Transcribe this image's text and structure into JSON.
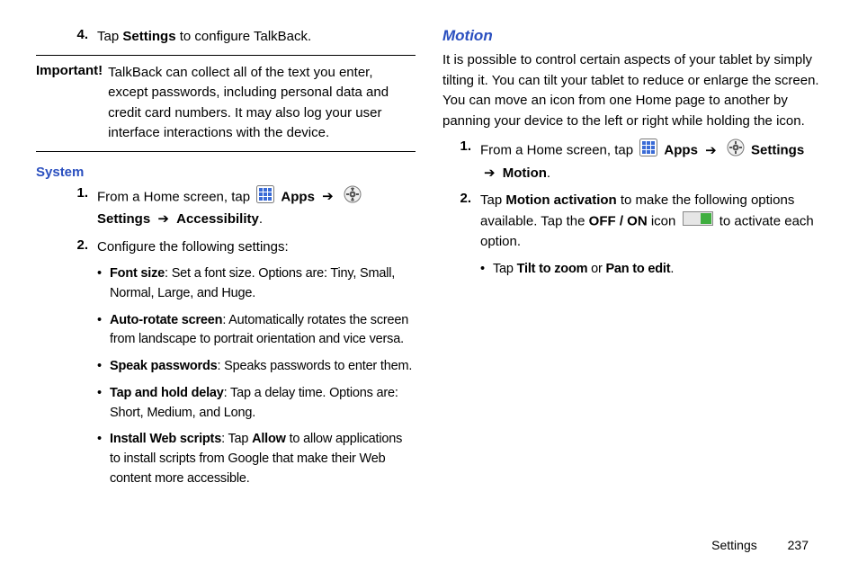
{
  "left": {
    "step4_num": "4.",
    "step4_pre": "Tap ",
    "step4_bold": "Settings",
    "step4_post": " to configure TalkBack.",
    "important_label": "Important!",
    "important_body": "TalkBack can collect all of the text you enter, except passwords, including personal data and credit card numbers. It may also log your user interface interactions with the device.",
    "system_head": "System",
    "sys1_num": "1.",
    "sys1_pre": "From a Home screen, tap ",
    "apps_label": "Apps",
    "settings_label": "Settings",
    "sys1_target": "Accessibility",
    "sys2_num": "2.",
    "sys2_body": "Configure the following settings:",
    "bullets": [
      {
        "b": "Font size",
        "t": ": Set a font size. Options are: Tiny, Small, Normal, Large, and Huge."
      },
      {
        "b": "Auto-rotate screen",
        "t": ": Automatically rotates the screen from landscape to portrait orientation and vice versa."
      },
      {
        "b": "Speak passwords",
        "t": ": Speaks passwords to enter them."
      },
      {
        "b": "Tap and hold delay",
        "t": ": Tap a delay time. Options are: Short, Medium, and Long."
      },
      {
        "b": "Install Web scripts",
        "t1": ": Tap ",
        "b2": "Allow",
        "t2": " to allow applications to install scripts from Google that make their Web content more accessible."
      }
    ]
  },
  "right": {
    "motion_head": "Motion",
    "motion_intro": "It is possible to control certain aspects of your tablet by simply tilting it. You can tilt your tablet to reduce or enlarge the screen. You can move an icon from one Home page to another by panning your device to the left or right while holding the icon.",
    "m1_num": "1.",
    "m1_pre": "From a Home screen, tap ",
    "m1_target": "Motion",
    "m2_num": "2.",
    "m2_pre": "Tap ",
    "m2_b1": "Motion activation",
    "m2_mid": " to make the following options available. Tap the ",
    "m2_b2": "OFF / ON",
    "m2_mid2": " icon ",
    "m2_post": " to activate each option.",
    "m2_sub_pre": "Tap ",
    "m2_sub_b1": "Tilt to zoom",
    "m2_sub_mid": " or ",
    "m2_sub_b2": "Pan to edit",
    "m2_sub_post": "."
  },
  "arrow": "➔",
  "period": ".",
  "footer_section": "Settings",
  "footer_page": "237"
}
